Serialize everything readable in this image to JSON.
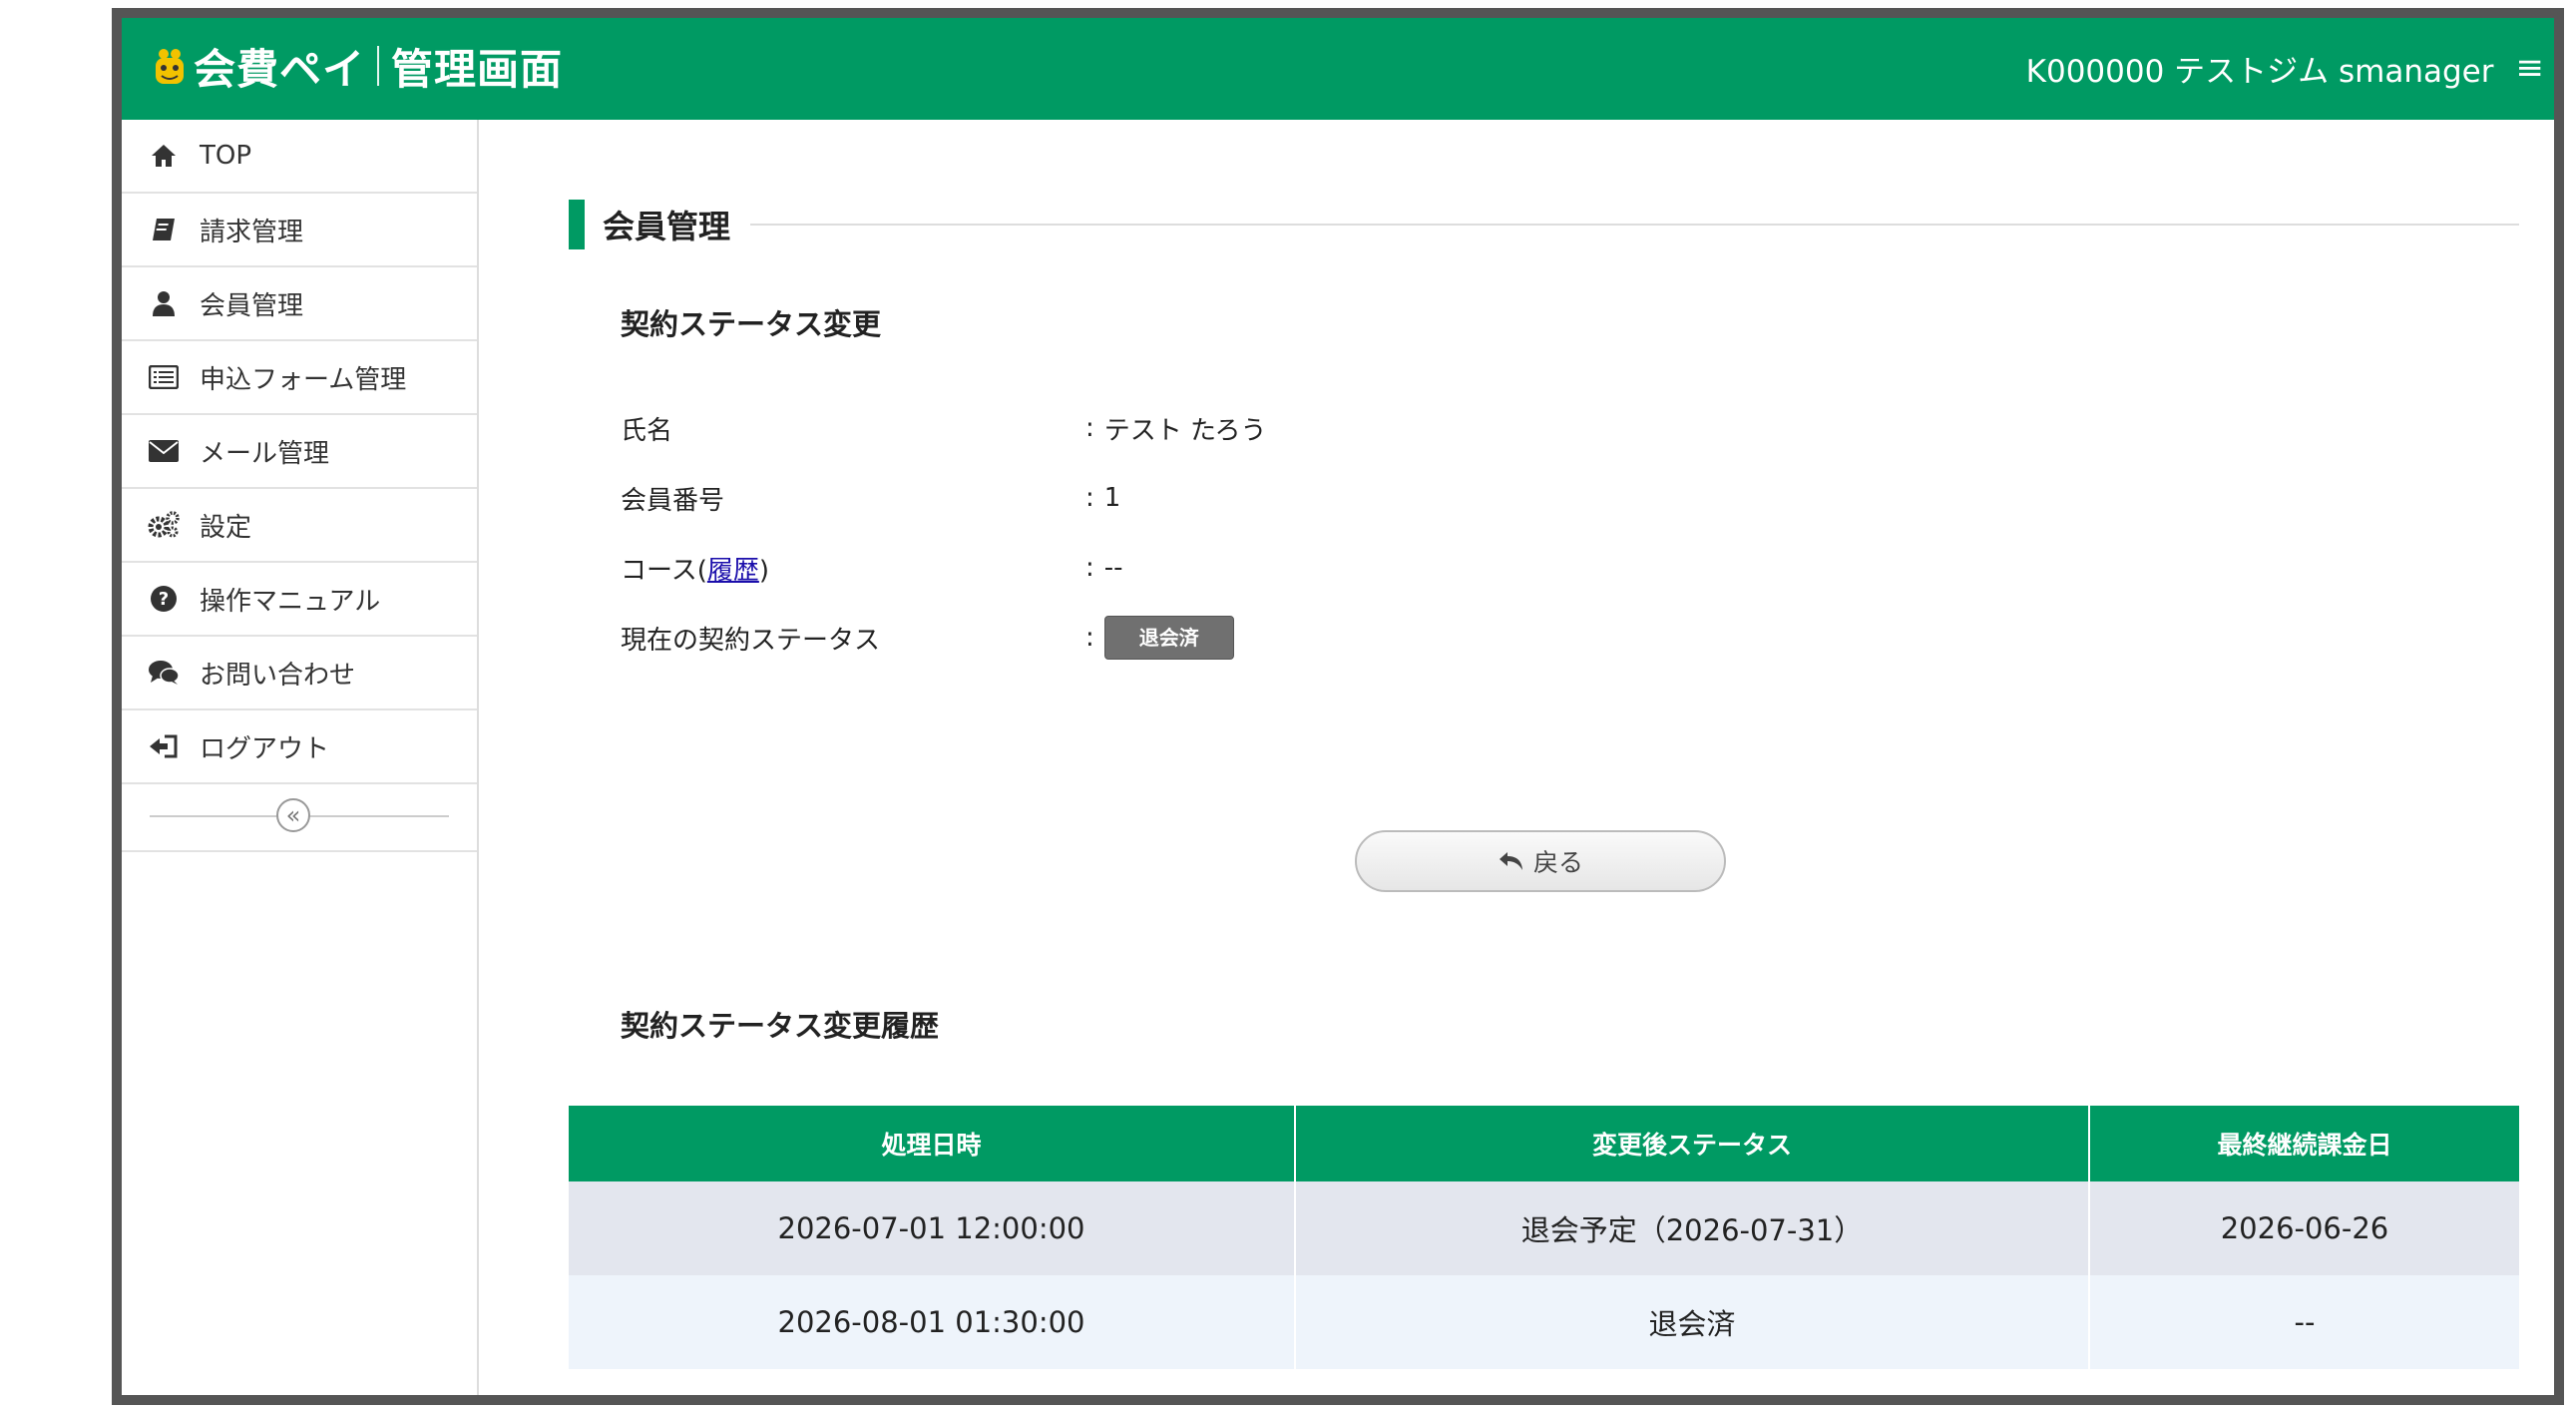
{
  "header": {
    "app_name_part1": "会費ペイ",
    "app_name_part2": "管理画面",
    "user_label": "K000000 テストジム smanager"
  },
  "sidebar": {
    "items": [
      {
        "label": "TOP",
        "icon": "home-icon"
      },
      {
        "label": "請求管理",
        "icon": "book-icon"
      },
      {
        "label": "会員管理",
        "icon": "user-icon"
      },
      {
        "label": "申込フォーム管理",
        "icon": "list-icon"
      },
      {
        "label": "メール管理",
        "icon": "envelope-icon"
      },
      {
        "label": "設定",
        "icon": "gears-icon"
      },
      {
        "label": "操作マニュアル",
        "icon": "question-icon"
      },
      {
        "label": "お問い合わせ",
        "icon": "chat-icon"
      },
      {
        "label": "ログアウト",
        "icon": "logout-icon"
      }
    ],
    "collapse_symbol": "«"
  },
  "main": {
    "section_title": "会員管理",
    "subsection_title": "契約ステータス変更",
    "fields": {
      "name_label": "氏名",
      "name_value": "テスト たろう",
      "member_no_label": "会員番号",
      "member_no_value": "1",
      "course_label_prefix": "コース(",
      "course_history_link": "履歴",
      "course_label_suffix": ")",
      "course_value": "--",
      "status_label": "現在の契約ステータス",
      "status_badge": "退会済"
    },
    "separator": ":",
    "back_button": "戻る",
    "history_title": "契約ステータス変更履歴",
    "history_table": {
      "headers": [
        "処理日時",
        "変更後ステータス",
        "最終継続課金日"
      ],
      "rows": [
        [
          "2026-07-01 12:00:00",
          "退会予定（2026-07-31）",
          "2026-06-26"
        ],
        [
          "2026-08-01 01:30:00",
          "退会済",
          "--"
        ]
      ]
    }
  },
  "colors": {
    "brand_green": "#009a63",
    "badge_gray": "#707070",
    "row_odd": "#e3e6ee",
    "row_even": "#eef4fb"
  }
}
